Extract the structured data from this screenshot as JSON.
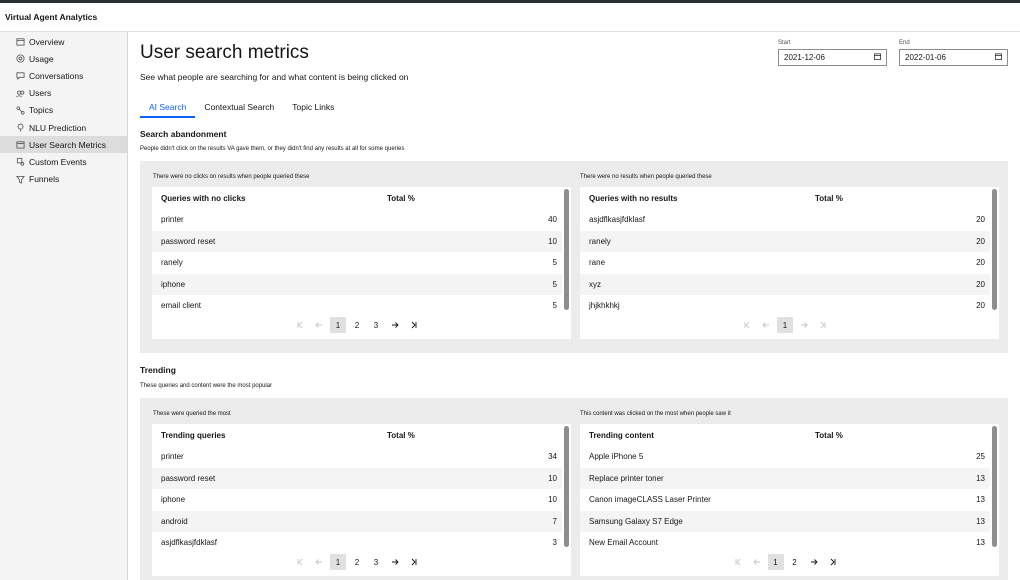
{
  "app": {
    "title": "Virtual Agent Analytics"
  },
  "sidebar": {
    "items": [
      {
        "label": "Overview",
        "icon": "calendar-icon"
      },
      {
        "label": "Usage",
        "icon": "gauge-icon"
      },
      {
        "label": "Conversations",
        "icon": "chat-icon"
      },
      {
        "label": "Users",
        "icon": "users-icon"
      },
      {
        "label": "Topics",
        "icon": "topics-icon"
      },
      {
        "label": "NLU Prediction",
        "icon": "bulb-icon"
      },
      {
        "label": "User Search Metrics",
        "icon": "search-metrics-icon",
        "active": true
      },
      {
        "label": "Custom Events",
        "icon": "custom-events-icon"
      },
      {
        "label": "Funnels",
        "icon": "funnel-icon"
      }
    ]
  },
  "page": {
    "title": "User search metrics",
    "subtitle": "See what people are searching for and what content is being clicked on"
  },
  "dates": {
    "start_label": "Start",
    "start_value": "2021-12-06",
    "end_label": "End",
    "end_value": "2022-01-06"
  },
  "tabs": [
    {
      "label": "AI Search",
      "active": true
    },
    {
      "label": "Contextual Search"
    },
    {
      "label": "Topic Links"
    }
  ],
  "abandonment": {
    "title": "Search abandonment",
    "desc": "People didn't click on the results VA gave them, or they didn't find any results at all for some queries",
    "no_clicks": {
      "desc": "There were no clicks on results when people queried these",
      "col1": "Queries with no clicks",
      "col2": "Total %",
      "rows": [
        {
          "name": "printer",
          "value": "40"
        },
        {
          "name": "password reset",
          "value": "10"
        },
        {
          "name": "ranely",
          "value": "5"
        },
        {
          "name": "iphone",
          "value": "5"
        },
        {
          "name": "email client",
          "value": "5"
        }
      ],
      "pages": [
        "1",
        "2",
        "3"
      ]
    },
    "no_results": {
      "desc": "There were no results when people queried these",
      "col1": "Queries with no results",
      "col2": "Total %",
      "rows": [
        {
          "name": "asjdflkasjfdklasf",
          "value": "20"
        },
        {
          "name": "ranely",
          "value": "20"
        },
        {
          "name": "rane",
          "value": "20"
        },
        {
          "name": "xyz",
          "value": "20"
        },
        {
          "name": "jhjkhkhkj",
          "value": "20"
        }
      ],
      "pages": [
        "1"
      ]
    }
  },
  "trending": {
    "title": "Trending",
    "desc": "These queries and content were the most popular",
    "queries": {
      "desc": "These were queried the most",
      "col1": "Trending queries",
      "col2": "Total %",
      "rows": [
        {
          "name": "printer",
          "value": "34"
        },
        {
          "name": "password reset",
          "value": "10"
        },
        {
          "name": "iphone",
          "value": "10"
        },
        {
          "name": "android",
          "value": "7"
        },
        {
          "name": "asjdflkasjfdklasf",
          "value": "3"
        }
      ],
      "pages": [
        "1",
        "2",
        "3"
      ]
    },
    "content": {
      "desc": "This content was clicked on the most when people saw it",
      "col1": "Trending content",
      "col2": "Total %",
      "rows": [
        {
          "name": "Apple iPhone 5",
          "value": "25"
        },
        {
          "name": "Replace printer toner",
          "value": "13"
        },
        {
          "name": "Canon imageCLASS Laser Printer",
          "value": "13"
        },
        {
          "name": "Samsung Galaxy S7 Edge",
          "value": "13"
        },
        {
          "name": "New Email Account",
          "value": "13"
        }
      ],
      "pages": [
        "1",
        "2"
      ]
    }
  }
}
